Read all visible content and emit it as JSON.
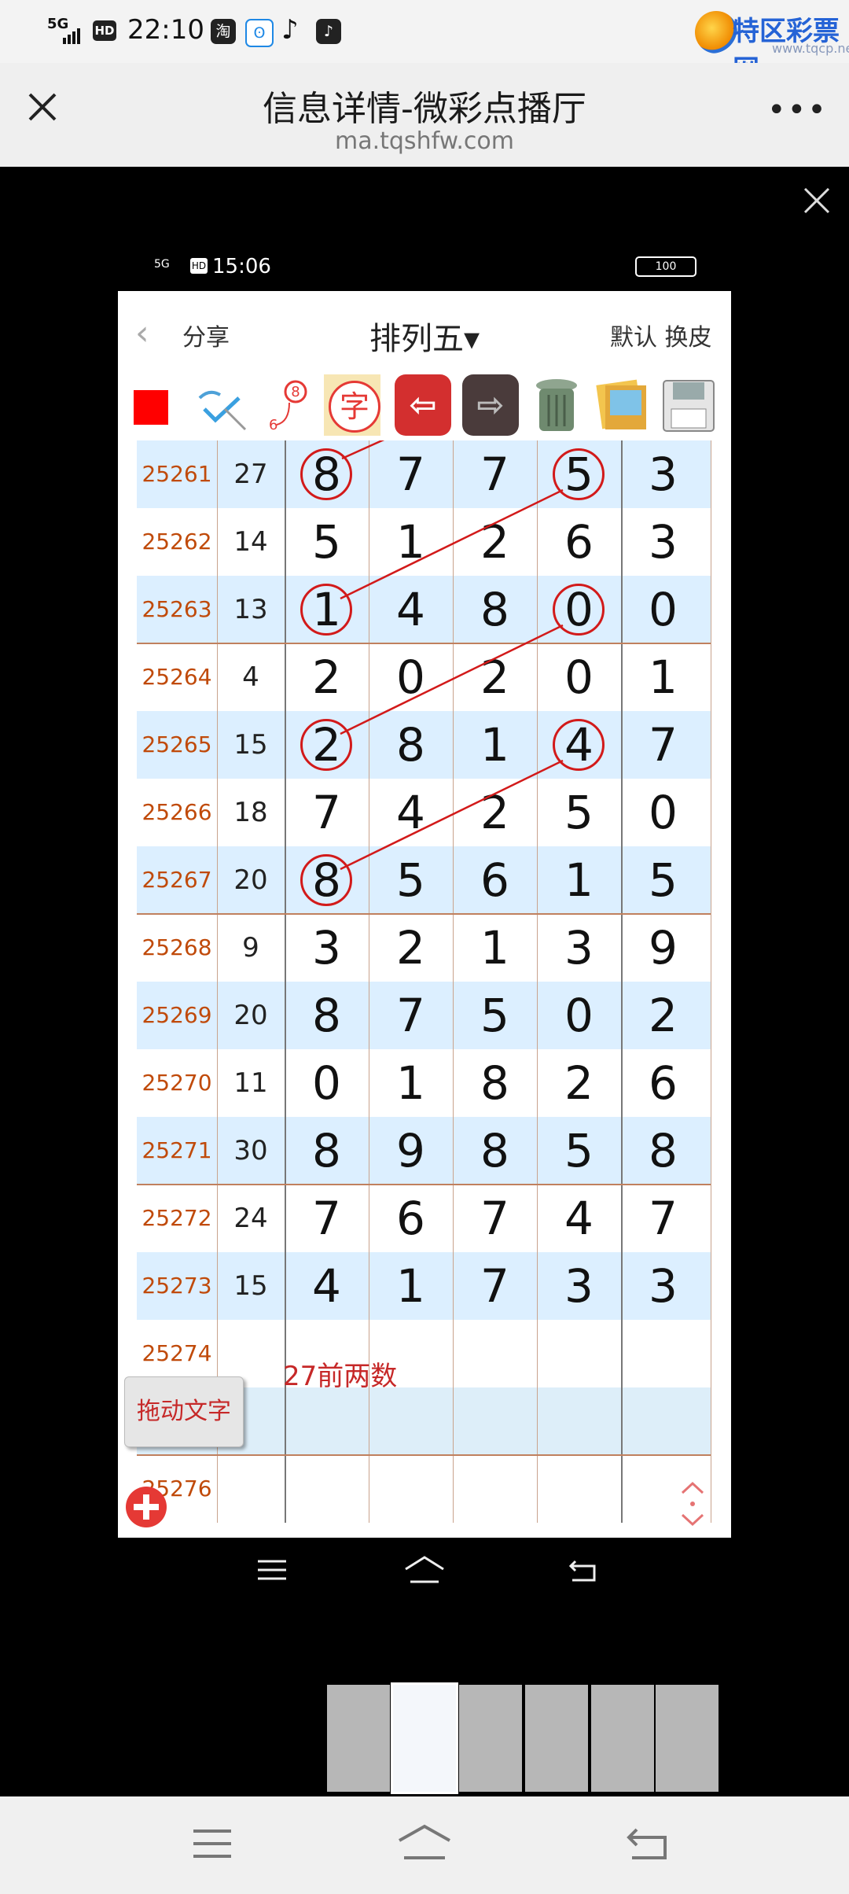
{
  "status_bar": {
    "network": "5G",
    "hd": "HD",
    "time": "22:10",
    "app_icons": [
      "taobao-icon",
      "bilibili-icon",
      "tiktok-icon",
      "tiktok-icon"
    ]
  },
  "watermark": {
    "brand": "特区彩票网",
    "sub": "www.tqcp.net"
  },
  "browser": {
    "title": "信息详情-微彩点播厅",
    "url": "ma.tqshfw.com"
  },
  "inner_status": {
    "network": "5G",
    "hd": "HD",
    "time": "15:06",
    "battery": "100"
  },
  "app_header": {
    "share": "分享",
    "title": "排列五▾",
    "right": "默认 换皮"
  },
  "toolbar": {
    "icons": [
      "red-square-icon",
      "check-icon",
      "dice-icon",
      "char-icon",
      "back-arrow-icon",
      "forward-arrow-icon",
      "trash-icon",
      "photos-icon",
      "save-disk-icon"
    ],
    "badge_top": "8",
    "badge_bottom": "6",
    "char": "字"
  },
  "table": {
    "rows": [
      {
        "issue": "25261",
        "sum": "27",
        "digits": [
          "8",
          "7",
          "7",
          "5",
          "3"
        ]
      },
      {
        "issue": "25262",
        "sum": "14",
        "digits": [
          "5",
          "1",
          "2",
          "6",
          "3"
        ]
      },
      {
        "issue": "25263",
        "sum": "13",
        "digits": [
          "1",
          "4",
          "8",
          "0",
          "0"
        ]
      },
      {
        "issue": "25264",
        "sum": "4",
        "digits": [
          "2",
          "0",
          "2",
          "0",
          "1"
        ]
      },
      {
        "issue": "25265",
        "sum": "15",
        "digits": [
          "2",
          "8",
          "1",
          "4",
          "7"
        ]
      },
      {
        "issue": "25266",
        "sum": "18",
        "digits": [
          "7",
          "4",
          "2",
          "5",
          "0"
        ]
      },
      {
        "issue": "25267",
        "sum": "20",
        "digits": [
          "8",
          "5",
          "6",
          "1",
          "5"
        ]
      },
      {
        "issue": "25268",
        "sum": "9",
        "digits": [
          "3",
          "2",
          "1",
          "3",
          "9"
        ]
      },
      {
        "issue": "25269",
        "sum": "20",
        "digits": [
          "8",
          "7",
          "5",
          "0",
          "2"
        ]
      },
      {
        "issue": "25270",
        "sum": "11",
        "digits": [
          "0",
          "1",
          "8",
          "2",
          "6"
        ]
      },
      {
        "issue": "25271",
        "sum": "30",
        "digits": [
          "8",
          "9",
          "8",
          "5",
          "8"
        ]
      },
      {
        "issue": "25272",
        "sum": "24",
        "digits": [
          "7",
          "6",
          "7",
          "4",
          "7"
        ]
      },
      {
        "issue": "25273",
        "sum": "15",
        "digits": [
          "4",
          "1",
          "7",
          "3",
          "3"
        ]
      },
      {
        "issue": "25274",
        "sum": "",
        "digits": [
          "",
          "",
          "",
          "",
          ""
        ]
      },
      {
        "issue": "",
        "sum": "",
        "digits": [
          "",
          "",
          "",
          "",
          ""
        ]
      },
      {
        "issue": "25276",
        "sum": "",
        "digits": [
          "",
          "",
          "",
          "",
          ""
        ]
      }
    ]
  },
  "note": "27前两数",
  "drag_button": "拖动文字"
}
